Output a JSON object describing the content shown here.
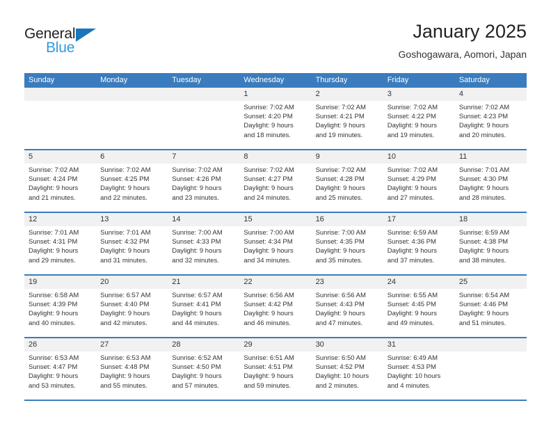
{
  "brand": {
    "name_top": "General",
    "name_bottom": "Blue",
    "accent_blue": "#2e9bdf",
    "triangle_blue": "#1b75bb",
    "header_blue": "#3a7cbe"
  },
  "header": {
    "title": "January 2025",
    "location": "Goshogawara, Aomori, Japan"
  },
  "calendar": {
    "weekdays": [
      "Sunday",
      "Monday",
      "Tuesday",
      "Wednesday",
      "Thursday",
      "Friday",
      "Saturday"
    ],
    "weeks": [
      [
        {
          "day": "",
          "empty": true,
          "lines": []
        },
        {
          "day": "",
          "empty": true,
          "lines": []
        },
        {
          "day": "",
          "empty": true,
          "lines": []
        },
        {
          "day": "1",
          "empty": false,
          "lines": [
            "Sunrise: 7:02 AM",
            "Sunset: 4:20 PM",
            "Daylight: 9 hours",
            "and 18 minutes."
          ]
        },
        {
          "day": "2",
          "empty": false,
          "lines": [
            "Sunrise: 7:02 AM",
            "Sunset: 4:21 PM",
            "Daylight: 9 hours",
            "and 19 minutes."
          ]
        },
        {
          "day": "3",
          "empty": false,
          "lines": [
            "Sunrise: 7:02 AM",
            "Sunset: 4:22 PM",
            "Daylight: 9 hours",
            "and 19 minutes."
          ]
        },
        {
          "day": "4",
          "empty": false,
          "lines": [
            "Sunrise: 7:02 AM",
            "Sunset: 4:23 PM",
            "Daylight: 9 hours",
            "and 20 minutes."
          ]
        }
      ],
      [
        {
          "day": "5",
          "empty": false,
          "lines": [
            "Sunrise: 7:02 AM",
            "Sunset: 4:24 PM",
            "Daylight: 9 hours",
            "and 21 minutes."
          ]
        },
        {
          "day": "6",
          "empty": false,
          "lines": [
            "Sunrise: 7:02 AM",
            "Sunset: 4:25 PM",
            "Daylight: 9 hours",
            "and 22 minutes."
          ]
        },
        {
          "day": "7",
          "empty": false,
          "lines": [
            "Sunrise: 7:02 AM",
            "Sunset: 4:26 PM",
            "Daylight: 9 hours",
            "and 23 minutes."
          ]
        },
        {
          "day": "8",
          "empty": false,
          "lines": [
            "Sunrise: 7:02 AM",
            "Sunset: 4:27 PM",
            "Daylight: 9 hours",
            "and 24 minutes."
          ]
        },
        {
          "day": "9",
          "empty": false,
          "lines": [
            "Sunrise: 7:02 AM",
            "Sunset: 4:28 PM",
            "Daylight: 9 hours",
            "and 25 minutes."
          ]
        },
        {
          "day": "10",
          "empty": false,
          "lines": [
            "Sunrise: 7:02 AM",
            "Sunset: 4:29 PM",
            "Daylight: 9 hours",
            "and 27 minutes."
          ]
        },
        {
          "day": "11",
          "empty": false,
          "lines": [
            "Sunrise: 7:01 AM",
            "Sunset: 4:30 PM",
            "Daylight: 9 hours",
            "and 28 minutes."
          ]
        }
      ],
      [
        {
          "day": "12",
          "empty": false,
          "lines": [
            "Sunrise: 7:01 AM",
            "Sunset: 4:31 PM",
            "Daylight: 9 hours",
            "and 29 minutes."
          ]
        },
        {
          "day": "13",
          "empty": false,
          "lines": [
            "Sunrise: 7:01 AM",
            "Sunset: 4:32 PM",
            "Daylight: 9 hours",
            "and 31 minutes."
          ]
        },
        {
          "day": "14",
          "empty": false,
          "lines": [
            "Sunrise: 7:00 AM",
            "Sunset: 4:33 PM",
            "Daylight: 9 hours",
            "and 32 minutes."
          ]
        },
        {
          "day": "15",
          "empty": false,
          "lines": [
            "Sunrise: 7:00 AM",
            "Sunset: 4:34 PM",
            "Daylight: 9 hours",
            "and 34 minutes."
          ]
        },
        {
          "day": "16",
          "empty": false,
          "lines": [
            "Sunrise: 7:00 AM",
            "Sunset: 4:35 PM",
            "Daylight: 9 hours",
            "and 35 minutes."
          ]
        },
        {
          "day": "17",
          "empty": false,
          "lines": [
            "Sunrise: 6:59 AM",
            "Sunset: 4:36 PM",
            "Daylight: 9 hours",
            "and 37 minutes."
          ]
        },
        {
          "day": "18",
          "empty": false,
          "lines": [
            "Sunrise: 6:59 AM",
            "Sunset: 4:38 PM",
            "Daylight: 9 hours",
            "and 38 minutes."
          ]
        }
      ],
      [
        {
          "day": "19",
          "empty": false,
          "lines": [
            "Sunrise: 6:58 AM",
            "Sunset: 4:39 PM",
            "Daylight: 9 hours",
            "and 40 minutes."
          ]
        },
        {
          "day": "20",
          "empty": false,
          "lines": [
            "Sunrise: 6:57 AM",
            "Sunset: 4:40 PM",
            "Daylight: 9 hours",
            "and 42 minutes."
          ]
        },
        {
          "day": "21",
          "empty": false,
          "lines": [
            "Sunrise: 6:57 AM",
            "Sunset: 4:41 PM",
            "Daylight: 9 hours",
            "and 44 minutes."
          ]
        },
        {
          "day": "22",
          "empty": false,
          "lines": [
            "Sunrise: 6:56 AM",
            "Sunset: 4:42 PM",
            "Daylight: 9 hours",
            "and 46 minutes."
          ]
        },
        {
          "day": "23",
          "empty": false,
          "lines": [
            "Sunrise: 6:56 AM",
            "Sunset: 4:43 PM",
            "Daylight: 9 hours",
            "and 47 minutes."
          ]
        },
        {
          "day": "24",
          "empty": false,
          "lines": [
            "Sunrise: 6:55 AM",
            "Sunset: 4:45 PM",
            "Daylight: 9 hours",
            "and 49 minutes."
          ]
        },
        {
          "day": "25",
          "empty": false,
          "lines": [
            "Sunrise: 6:54 AM",
            "Sunset: 4:46 PM",
            "Daylight: 9 hours",
            "and 51 minutes."
          ]
        }
      ],
      [
        {
          "day": "26",
          "empty": false,
          "lines": [
            "Sunrise: 6:53 AM",
            "Sunset: 4:47 PM",
            "Daylight: 9 hours",
            "and 53 minutes."
          ]
        },
        {
          "day": "27",
          "empty": false,
          "lines": [
            "Sunrise: 6:53 AM",
            "Sunset: 4:48 PM",
            "Daylight: 9 hours",
            "and 55 minutes."
          ]
        },
        {
          "day": "28",
          "empty": false,
          "lines": [
            "Sunrise: 6:52 AM",
            "Sunset: 4:50 PM",
            "Daylight: 9 hours",
            "and 57 minutes."
          ]
        },
        {
          "day": "29",
          "empty": false,
          "lines": [
            "Sunrise: 6:51 AM",
            "Sunset: 4:51 PM",
            "Daylight: 9 hours",
            "and 59 minutes."
          ]
        },
        {
          "day": "30",
          "empty": false,
          "lines": [
            "Sunrise: 6:50 AM",
            "Sunset: 4:52 PM",
            "Daylight: 10 hours",
            "and 2 minutes."
          ]
        },
        {
          "day": "31",
          "empty": false,
          "lines": [
            "Sunrise: 6:49 AM",
            "Sunset: 4:53 PM",
            "Daylight: 10 hours",
            "and 4 minutes."
          ]
        },
        {
          "day": "",
          "empty": true,
          "lines": []
        }
      ]
    ]
  }
}
